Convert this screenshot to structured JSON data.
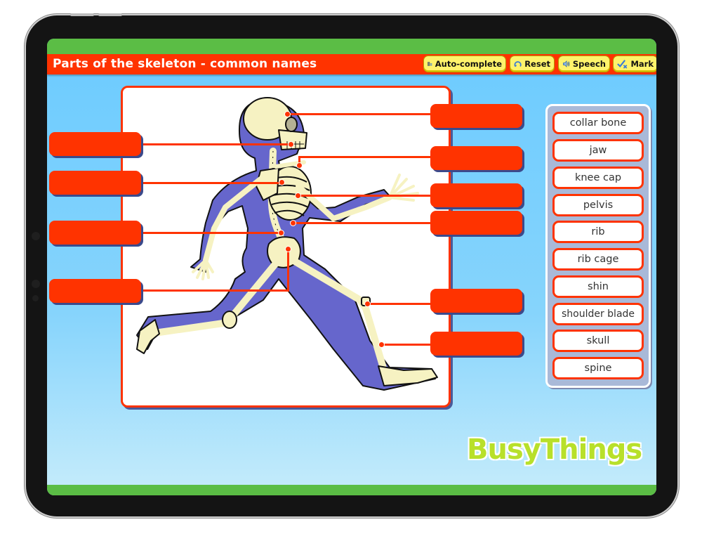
{
  "app": {
    "title": "Parts of the skeleton - common names",
    "brand": "BusyThings"
  },
  "toolbar": {
    "autocomplete_label": "Auto-complete",
    "reset_label": "Reset",
    "speech_label": "Speech",
    "mark_label": "Mark",
    "icons": [
      "autocomplete-icon",
      "reset-icon",
      "speaker-icon",
      "mark-icon"
    ]
  },
  "drop_zones": {
    "left": [
      "",
      "",
      "",
      ""
    ],
    "right": [
      "",
      "",
      "",
      "",
      "",
      ""
    ]
  },
  "word_bank": [
    "collar bone",
    "jaw",
    "knee cap",
    "pelvis",
    "rib",
    "rib cage",
    "shin",
    "shoulder blade",
    "skull",
    "spine"
  ],
  "colors": {
    "accent": "#ff3300",
    "header_green": "#5bbd45",
    "button_yellow": "#fff36b",
    "bone": "#f6f2c2",
    "body": "#6666cc",
    "word_panel": "#a9b9d8"
  }
}
